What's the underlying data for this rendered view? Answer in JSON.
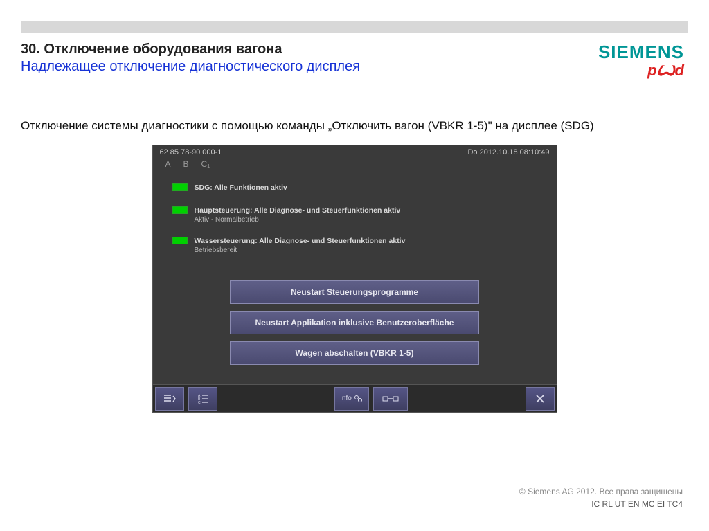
{
  "slide": {
    "title": "30. Отключение оборудования вагона",
    "subtitle": "Надлежащее отключение диагностического дисплея",
    "body": "Отключение системы диагностики с помощью команды „Отключить вагон (VBKR 1-5)\" на дисплее (SDG)"
  },
  "logos": {
    "siemens": "SIEMENS",
    "rzd": "pꙌd"
  },
  "sdg": {
    "train_id": "62 85 78-90 000-1",
    "datetime": "Do 2012.10.18 08:10:49",
    "tabs": {
      "a": "A",
      "b": "B",
      "c": "C₁"
    },
    "status": [
      {
        "main": "SDG: Alle Funktionen aktiv",
        "sub": ""
      },
      {
        "main": "Hauptsteuerung: Alle Diagnose- und Steuerfunktionen aktiv",
        "sub": "Aktiv - Normalbetrieb"
      },
      {
        "main": "Wassersteuerung: Alle Diagnose- und Steuerfunktionen aktiv",
        "sub": "Betriebsbereit"
      }
    ],
    "buttons": {
      "restart_programs": "Neustart Steuerungsprogramme",
      "restart_app": "Neustart Applikation inklusive Benutzeroberfläche",
      "shutdown_wagon": "Wagen abschalten (VBKR 1-5)"
    },
    "footer": {
      "info": "Info"
    }
  },
  "footer": {
    "copyright": "© Siemens AG 2012. Все права защищены",
    "code": "IC RL UT EN MC EI TC4"
  }
}
